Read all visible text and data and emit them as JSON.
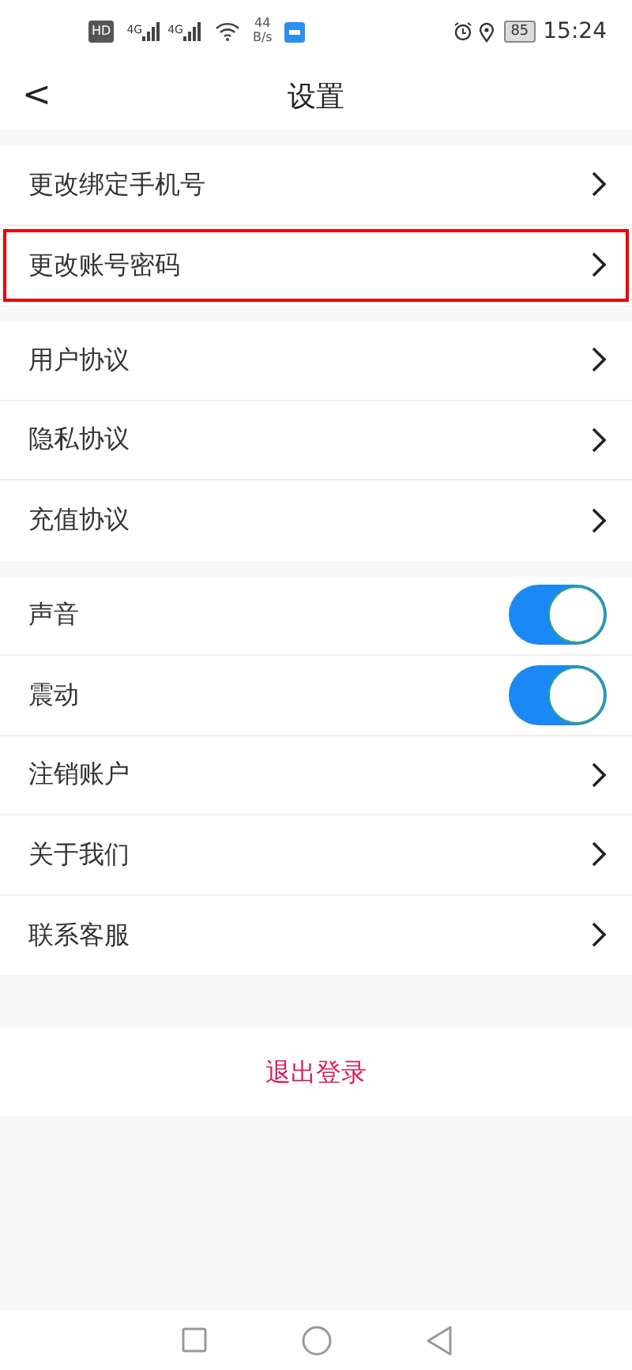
{
  "status_bar": {
    "network_badge": "HD",
    "signal_labels": [
      "4G",
      "4G"
    ],
    "speed_value": "44",
    "speed_unit": "B/s",
    "battery": "85",
    "time": "15:24"
  },
  "header": {
    "back": "<",
    "title": "设置"
  },
  "sections": [
    {
      "items": [
        {
          "kind": "link",
          "label": "更改绑定手机号",
          "highlighted": false
        },
        {
          "kind": "link",
          "label": "更改账号密码",
          "highlighted": true
        }
      ]
    },
    {
      "items": [
        {
          "kind": "link",
          "label": "用户协议",
          "highlighted": false
        },
        {
          "kind": "link",
          "label": "隐私协议",
          "highlighted": false
        },
        {
          "kind": "link",
          "label": "充值协议",
          "highlighted": false
        }
      ]
    },
    {
      "items": [
        {
          "kind": "toggle",
          "label": "声音",
          "on": true,
          "highlighted": false
        },
        {
          "kind": "toggle",
          "label": "震动",
          "on": true,
          "highlighted": false
        },
        {
          "kind": "link",
          "label": "注销账户",
          "highlighted": false
        },
        {
          "kind": "link",
          "label": "关于我们",
          "highlighted": false
        },
        {
          "kind": "link",
          "label": "联系客服",
          "highlighted": false
        }
      ]
    }
  ],
  "logout": "退出登录"
}
